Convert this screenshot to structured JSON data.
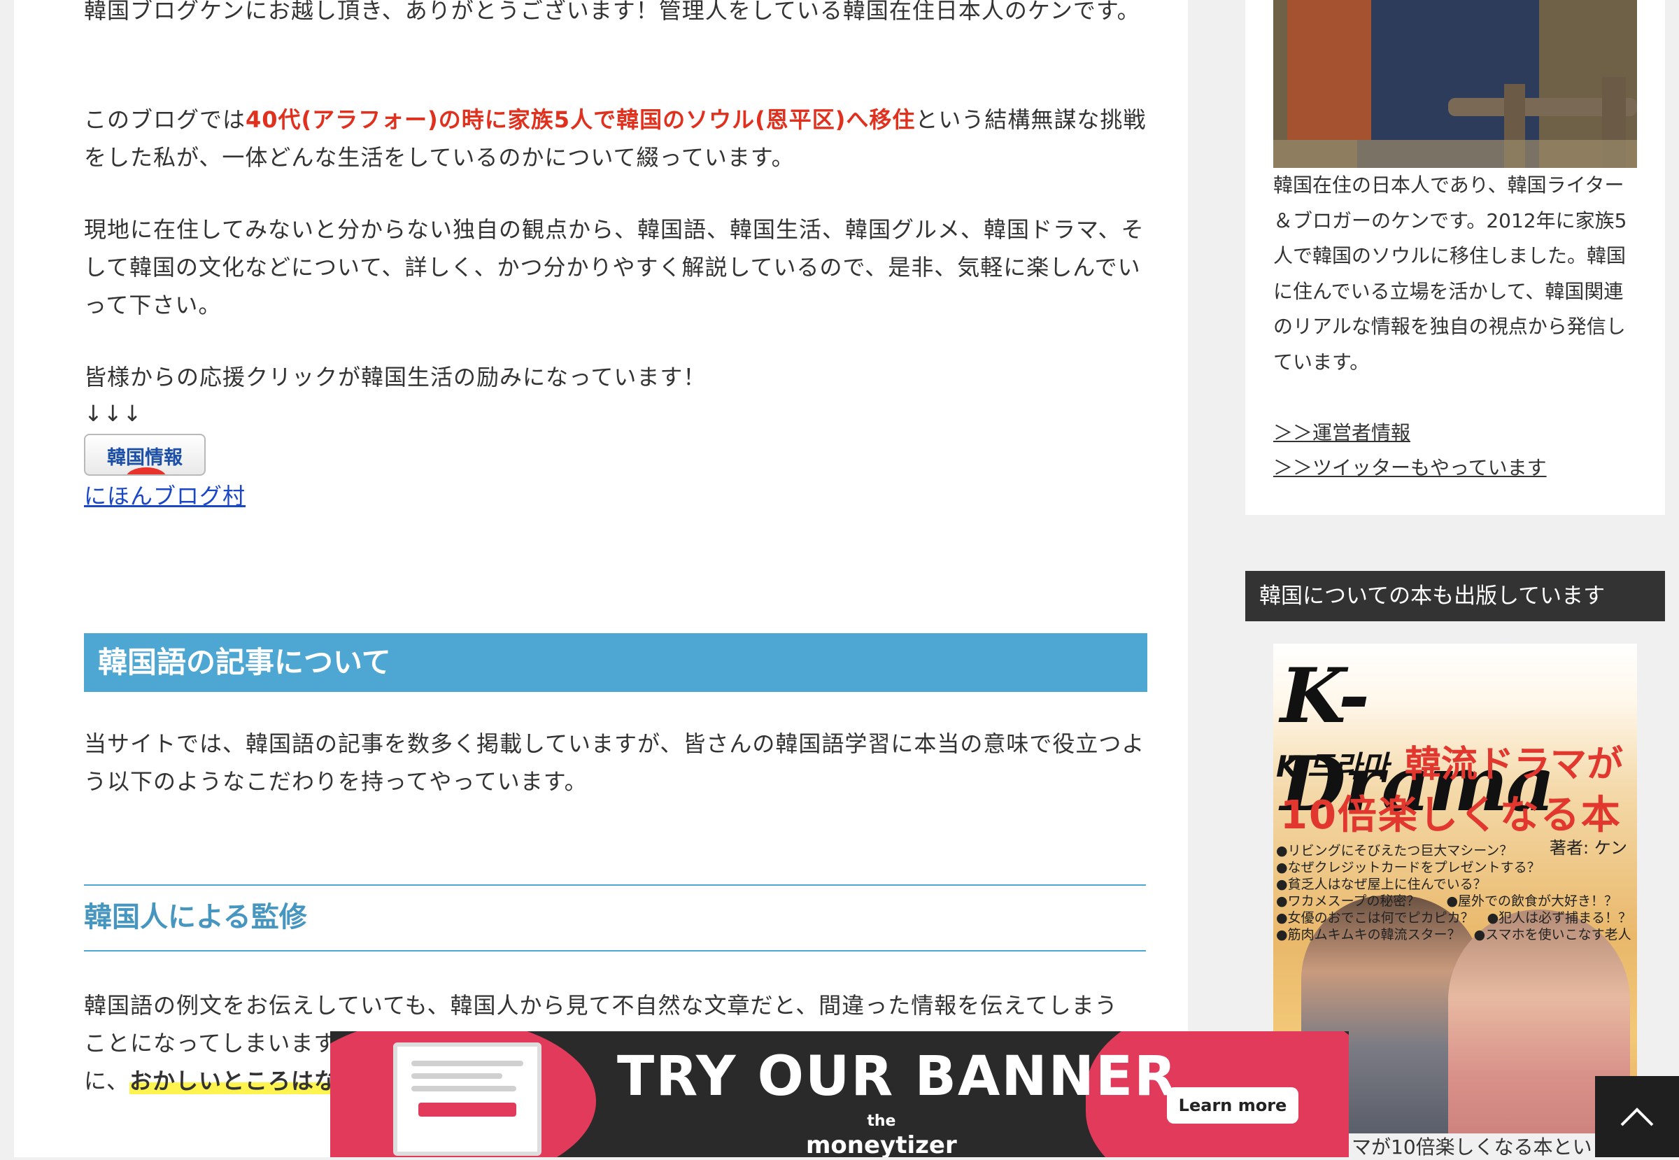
{
  "intro": {
    "line1": "韓国ブログケンにお越し頂き、ありがとうございます！管理人をしている韓国在住日本人のケンです。",
    "p2_before": "このブログでは",
    "p2_red": "40代(アラフォー)の時に家族5人で韓国のソウル(恩平区)へ移住",
    "p2_after": "という結構無謀な挑戦をした私が、一体どんな生活をしているのかについて綴っています。",
    "p3": "現地に在住してみないと分からない独自の観点から、韓国語、韓国生活、韓国グルメ、韓国ドラマ、そして韓国の文化などについて、詳しく、かつ分かりやすく解説しているので、是非、気軽に楽しんでいって下さい。",
    "p4": "皆様からの応援クリックが韓国生活の励みになっています！",
    "arrows": "↓↓↓",
    "banner_button": "韓国情報",
    "ranking_link": "にほんブログ村"
  },
  "section": {
    "h2": "韓国語の記事について",
    "p1": "当サイトでは、韓国語の記事を数多く掲載していますが、皆さんの韓国語学習に本当の意味で役立つよう以下のようなこだわりを持ってやっています。",
    "h3": "韓国人による監修",
    "p2_line1": "韓国語の例文をお伝えしていても、韓国人から見て不自然な文章だと、間違った情報を伝えてしまう",
    "p2_line2": "ことになってしまいます。",
    "p2_line3_before": "に、",
    "p2_highlight": "おかしいところはな"
  },
  "sidebar": {
    "profile_text": "韓国在住の日本人であり、韓国ライター＆ブロガーのケンです。2012年に家族5人で韓国のソウルに移住しました。韓国に住んでいる立場を活かして、韓国関連のリアルな情報を独自の視点から発信しています。",
    "link_operator": "＞＞運営者情報",
    "link_twitter": "＞＞ツイッターもやっています",
    "widget_title": "韓国についての本も出版しています",
    "book": {
      "title_en": "K-Drama",
      "title_kr": "K-드라마",
      "title_jp1": "韓流ドラマが",
      "title_jp2": "10倍楽しくなる本",
      "author": "著者: ケン",
      "bullets": [
        "●リビングにそびえたつ巨大マシーン？",
        "●なぜクレジットカードをプレゼントする？",
        "●貧乏人はなぜ屋上に住んでいる？",
        "●ワカメスープの秘密？　　●屋外での飲食が大好き！？",
        "●女優のおでこは何でピカピカ？　●犯人は必ず捕まる！？",
        "●筋肉ムキムキの韓流スター？　●スマホを使いこなす老人"
      ]
    },
    "book_caption": "マが10倍楽しくなる本とい"
  },
  "ad": {
    "headline": "TRY OUR BANNER",
    "brand_line1": "the",
    "brand_line2": "moneytizer",
    "button": "Learn more"
  },
  "icons": {
    "scroll_top": "chevron-up-icon"
  }
}
